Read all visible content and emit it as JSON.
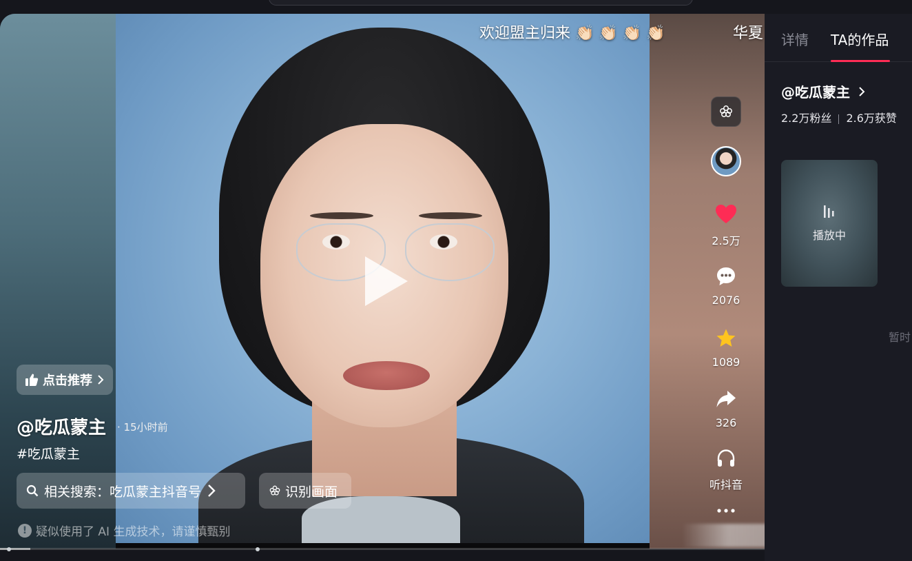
{
  "video": {
    "banner_text": "欢迎盟主归来 👏🏻 👏🏻 👏🏻 👏🏻",
    "banner_right_text": "华夏",
    "recommend_label": "点击推荐",
    "author": "@吃瓜蒙主",
    "post_time": "15小时前",
    "hashtag": "#吃瓜蒙主",
    "related_search_label": "相关搜索：吃瓜蒙主抖音号",
    "identify_label": "识别画面",
    "ai_warning": "疑似使用了 AI 生成技术，请谨慎甄别",
    "progress": 0.04
  },
  "actions": {
    "ai_icon": "ai-flower-icon",
    "like_count": "2.5万",
    "comment_count": "2076",
    "favorite_count": "1089",
    "share_count": "326",
    "listen_label": "听抖音",
    "more_icon": "more-icon"
  },
  "panel": {
    "tabs": [
      {
        "label": "详情"
      },
      {
        "label": "TA的作品"
      }
    ],
    "profile_name": "@吃瓜蒙主",
    "followers": "2.2万粉丝",
    "likes": "2.6万获赞",
    "playing_label": "播放中",
    "pending_text": "暂时"
  },
  "colors": {
    "accent": "#fe2c55",
    "like": "#fe2c55",
    "favorite": "#ffc41f",
    "panel_bg": "#1a1b23"
  }
}
